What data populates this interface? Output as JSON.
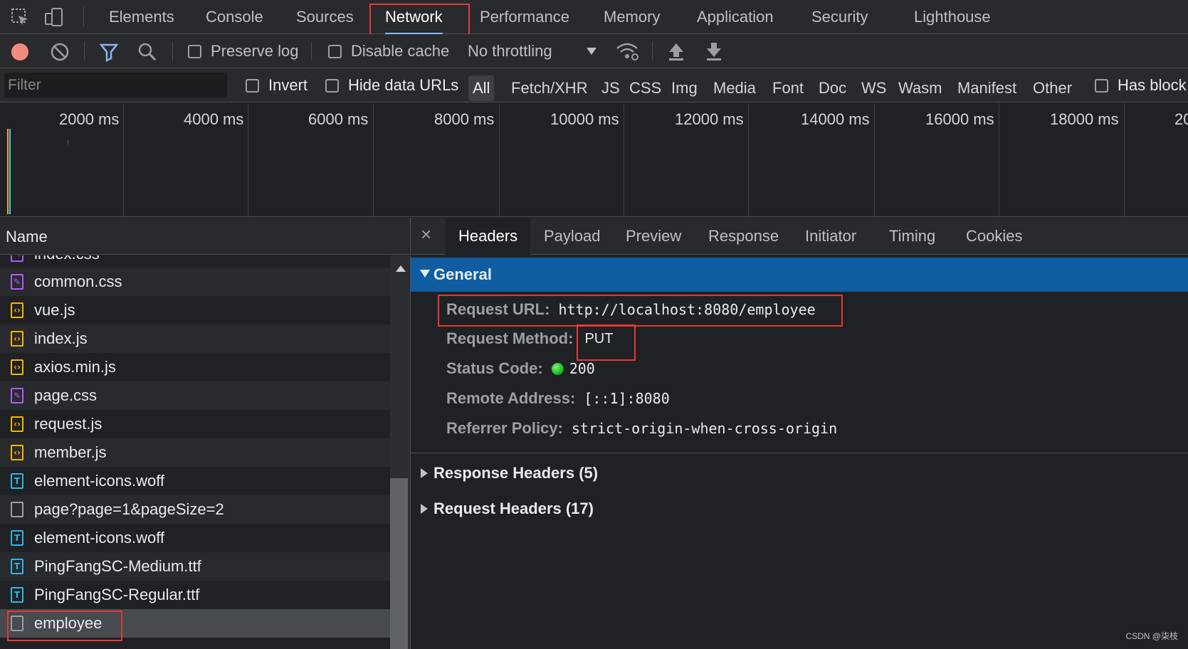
{
  "tabs": [
    "Elements",
    "Console",
    "Sources",
    "Network",
    "Performance",
    "Memory",
    "Application",
    "Security",
    "Lighthouse"
  ],
  "toolbar": {
    "preserve_log": "Preserve log",
    "disable_cache": "Disable cache",
    "throttling": "No throttling"
  },
  "filter": {
    "placeholder": "Filter",
    "invert": "Invert",
    "hide_data_urls": "Hide data URLs",
    "types": [
      "All",
      "Fetch/XHR",
      "JS",
      "CSS",
      "Img",
      "Media",
      "Font",
      "Doc",
      "WS",
      "Wasm",
      "Manifest",
      "Other"
    ],
    "has_blocked": "Has block"
  },
  "timeline": {
    "labels": [
      "2000 ms",
      "4000 ms",
      "6000 ms",
      "8000 ms",
      "10000 ms",
      "12000 ms",
      "14000 ms",
      "16000 ms",
      "18000 ms",
      "20"
    ]
  },
  "request_list": {
    "header": "Name",
    "items": [
      {
        "name": "index.css",
        "type": "css"
      },
      {
        "name": "common.css",
        "type": "css"
      },
      {
        "name": "vue.js",
        "type": "js"
      },
      {
        "name": "index.js",
        "type": "js"
      },
      {
        "name": "axios.min.js",
        "type": "js"
      },
      {
        "name": "page.css",
        "type": "css"
      },
      {
        "name": "request.js",
        "type": "js"
      },
      {
        "name": "member.js",
        "type": "js"
      },
      {
        "name": "element-icons.woff",
        "type": "font"
      },
      {
        "name": "page?page=1&pageSize=2",
        "type": "doc"
      },
      {
        "name": "element-icons.woff",
        "type": "font"
      },
      {
        "name": "PingFangSC-Medium.ttf",
        "type": "font"
      },
      {
        "name": "PingFangSC-Regular.ttf",
        "type": "font"
      },
      {
        "name": "employee",
        "type": "doc"
      }
    ]
  },
  "details": {
    "close": "×",
    "tabs": [
      "Headers",
      "Payload",
      "Preview",
      "Response",
      "Initiator",
      "Timing",
      "Cookies"
    ],
    "general": {
      "title": "General",
      "request_url_label": "Request URL:",
      "request_url": "http://localhost:8080/employee",
      "request_method_label": "Request Method:",
      "request_method": "PUT",
      "status_code_label": "Status Code:",
      "status_code": "200",
      "remote_address_label": "Remote Address:",
      "remote_address": "[::1]:8080",
      "referrer_policy_label": "Referrer Policy:",
      "referrer_policy": "strict-origin-when-cross-origin"
    },
    "response_headers": "Response Headers (5)",
    "request_headers": "Request Headers (17)"
  },
  "colors": {
    "highlight_box": "#e53935",
    "general_bar": "#0f5da0",
    "status_ok": "#0cae14"
  },
  "watermark": "CSDN @柒枝"
}
